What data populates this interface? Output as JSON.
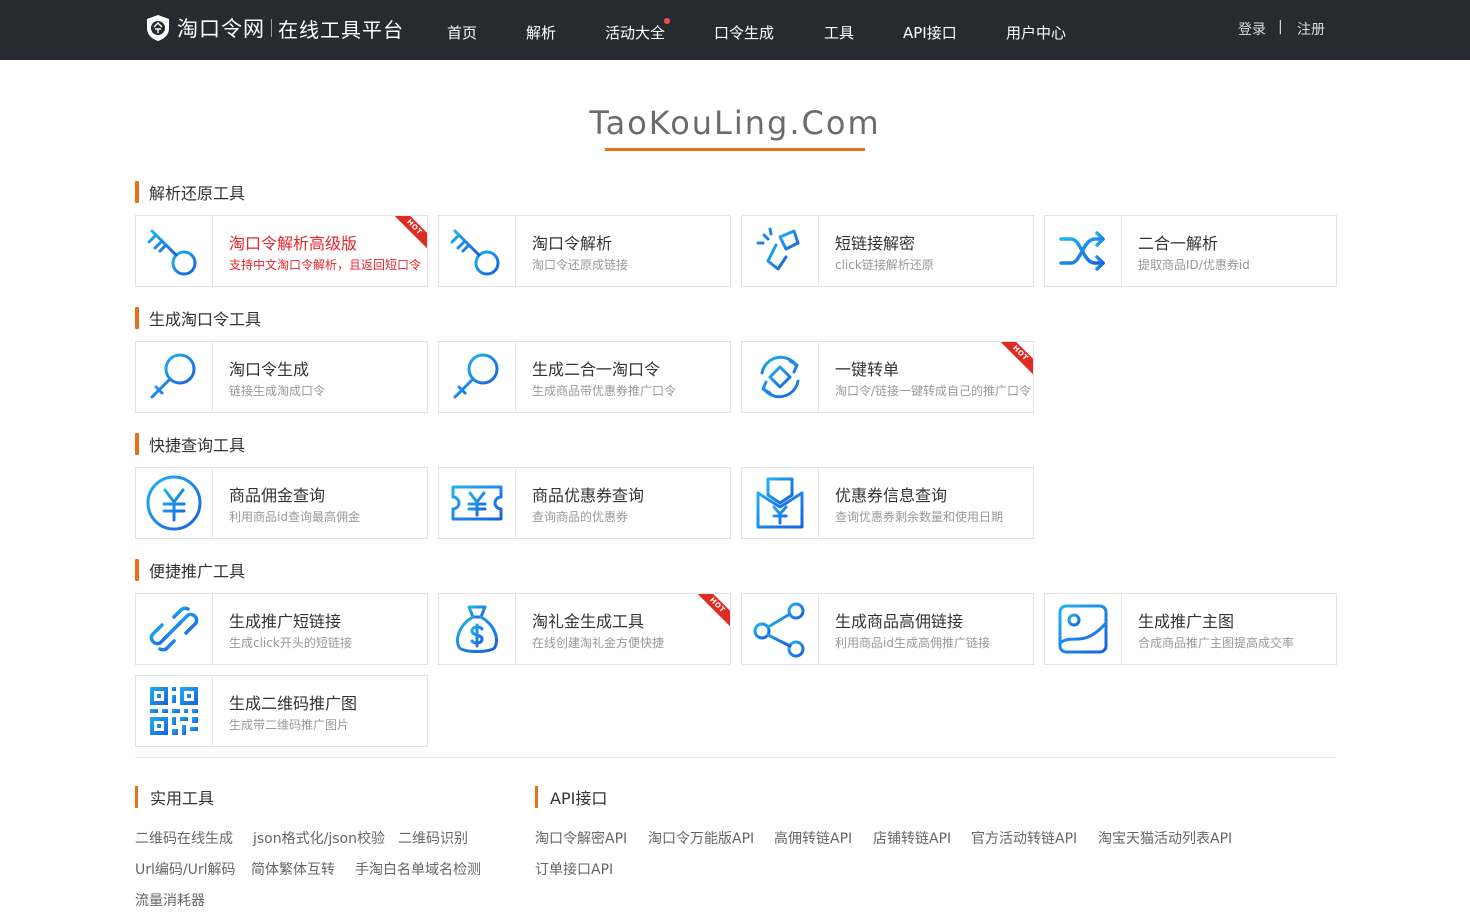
{
  "header": {
    "logo_name": "淘口令网",
    "logo_sub": "在线工具平台",
    "nav": [
      "首页",
      "解析",
      "活动大全",
      "口令生成",
      "工具",
      "API接口",
      "用户中心"
    ],
    "login": "登录",
    "separator": "|",
    "register": "注册"
  },
  "hero": {
    "title": "TaoKouLing.Com"
  },
  "sections": [
    {
      "title": "解析还原工具",
      "cards": [
        {
          "title": "淘口令解析高级版",
          "desc": "支持中文淘口令解析，且返回短口令",
          "icon": "key-icon",
          "hot": true,
          "highlight": true
        },
        {
          "title": "淘口令解析",
          "desc": "淘口令还原成链接",
          "icon": "key-icon",
          "hot": false
        },
        {
          "title": "短链接解密",
          "desc": "click链接解析还原",
          "icon": "broken-link-icon",
          "hot": false
        },
        {
          "title": "二合一解析",
          "desc": "提取商品ID/优惠券id",
          "icon": "shuffle-icon",
          "hot": false
        }
      ]
    },
    {
      "title": "生成淘口令工具",
      "cards": [
        {
          "title": "淘口令生成",
          "desc": "链接生成淘成口令",
          "icon": "magnifier-icon",
          "hot": false
        },
        {
          "title": "生成二合一淘口令",
          "desc": "生成商品带优惠券推广口令",
          "icon": "magnifier-icon",
          "hot": false
        },
        {
          "title": "一键转单",
          "desc": "淘口令/链接一键转成自己的推广口令",
          "icon": "refresh-diamond-icon",
          "hot": true
        }
      ]
    },
    {
      "title": "快捷查询工具",
      "cards": [
        {
          "title": "商品佣金查询",
          "desc": "利用商品id查询最高佣金",
          "icon": "yen-circle-icon",
          "hot": false
        },
        {
          "title": "商品优惠券查询",
          "desc": "查询商品的优惠券",
          "icon": "yen-ticket-icon",
          "hot": false
        },
        {
          "title": "优惠券信息查询",
          "desc": "查询优惠券剩余数量和使用日期",
          "icon": "yen-envelope-icon",
          "hot": false
        }
      ]
    },
    {
      "title": "便捷推广工具",
      "cards": [
        {
          "title": "生成推广短链接",
          "desc": "生成click开头的短链接",
          "icon": "chain-link-icon",
          "hot": false
        },
        {
          "title": "淘礼金生成工具",
          "desc": "在线创建淘礼金方便快捷",
          "icon": "money-bag-icon",
          "hot": true
        },
        {
          "title": "生成商品高佣链接",
          "desc": "利用商品id生成高佣推广链接",
          "icon": "share-icon",
          "hot": false
        },
        {
          "title": "生成推广主图",
          "desc": "合成商品推广主图提高成交率",
          "icon": "image-icon",
          "hot": false
        },
        {
          "title": "生成二维码推广图",
          "desc": "生成带二维码推广图片",
          "icon": "qr-code-icon",
          "hot": false
        }
      ]
    }
  ],
  "hot_label": "HOT",
  "tools_block": {
    "title": "实用工具",
    "links": [
      "二维码在线生成",
      "json格式化/json校验",
      "二维码识别",
      "Url编码/Url解码",
      "简体繁体互转",
      "手淘白名单域名检测",
      "流量消耗器"
    ]
  },
  "api_block": {
    "title": "API接口",
    "links": [
      "淘口令解密API",
      "淘口令万能版API",
      "高佣转链API",
      "店铺转链API",
      "官方活动转链API",
      "淘宝天猫活动列表API",
      "订单接口API"
    ]
  },
  "colors": {
    "header_bg": "#262b31",
    "accent": "#e8701a",
    "hot": "#e02b20",
    "icon_blue": "#1a8fe3"
  }
}
